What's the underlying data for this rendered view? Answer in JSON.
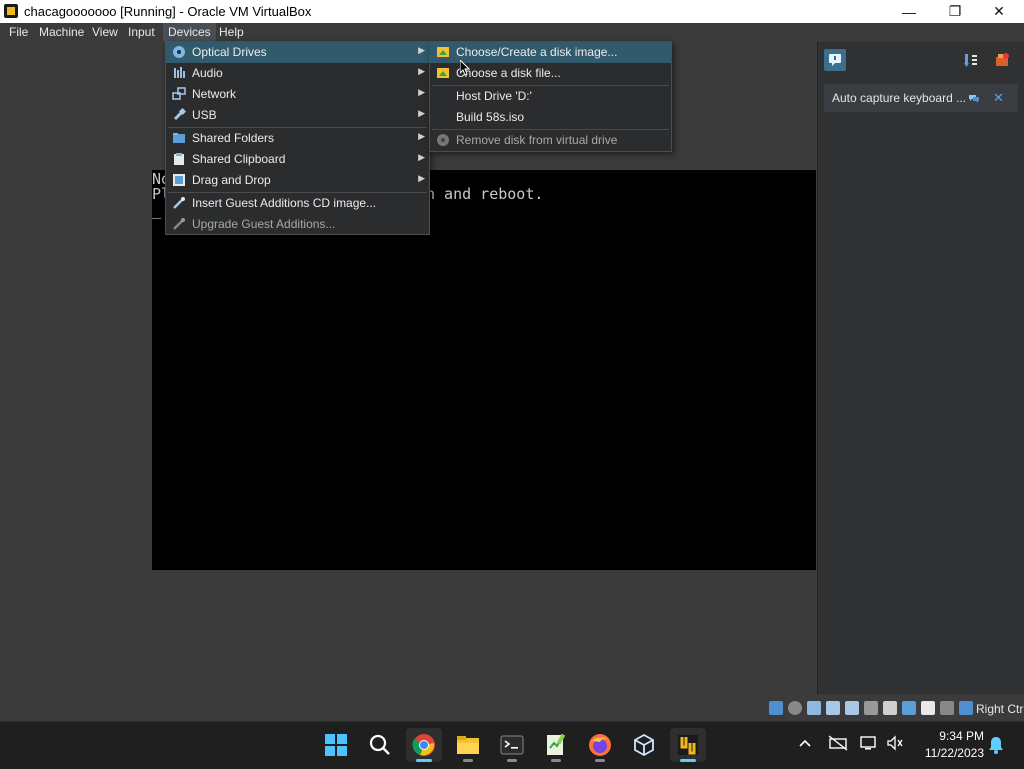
{
  "window": {
    "title": "chacagooooooo [Running] - Oracle VM VirtualBox",
    "minimize_glyph": "—",
    "restore_glyph": "❐",
    "close_glyph": "✕"
  },
  "menubar": {
    "items": [
      {
        "label": "File"
      },
      {
        "label": "Machine"
      },
      {
        "label": "View"
      },
      {
        "label": "Input"
      },
      {
        "label": "Devices"
      },
      {
        "label": "Help"
      }
    ]
  },
  "devices_menu": {
    "items": [
      {
        "label": "Optical Drives",
        "icon": "optical-disc-icon"
      },
      {
        "label": "Audio",
        "icon": "audio-icon"
      },
      {
        "label": "Network",
        "icon": "network-icon"
      },
      {
        "label": "USB",
        "icon": "usb-icon"
      },
      {
        "label": "Shared Folders",
        "icon": "shared-folder-icon"
      },
      {
        "label": "Shared Clipboard",
        "icon": "clipboard-icon"
      },
      {
        "label": "Drag and Drop",
        "icon": "drag-drop-icon"
      },
      {
        "label": "Insert Guest Additions CD image...",
        "icon": "guest-additions-icon"
      },
      {
        "label": "Upgrade Guest Additions...",
        "icon": "upgrade-icon"
      }
    ]
  },
  "optical_submenu": {
    "items": [
      {
        "label": "Choose/Create a disk image..."
      },
      {
        "label": "Choose a disk file..."
      },
      {
        "label": "Host Drive 'D:'"
      },
      {
        "label": "Build 58s.iso"
      },
      {
        "label": "Remove disk from virtual drive"
      }
    ]
  },
  "console": {
    "line1_visible": "No",
    "line2_left": "Pl",
    "line2_right": "n and reboot.",
    "cursor": "_"
  },
  "right_panel": {
    "notification_text": "Auto capture keyboard ...",
    "close_glyph": "✕"
  },
  "statusbar": {
    "host_key": "Right Ctrl"
  },
  "taskbar": {
    "time": "9:34 PM",
    "date": "11/22/2023"
  },
  "colors": {
    "highlight": "#315b6c",
    "vm_background": "#000000",
    "taskbar_accent": "#60cdff"
  }
}
